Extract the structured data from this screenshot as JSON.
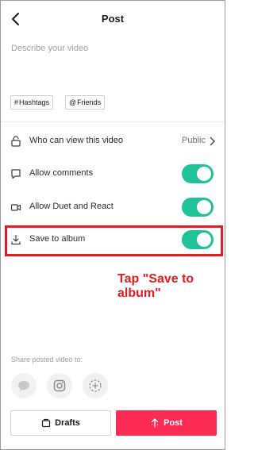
{
  "header": {
    "title": "Post"
  },
  "description": {
    "placeholder": "Describe your video"
  },
  "chips": {
    "hashtags_symbol": "#",
    "hashtags": "Hashtags",
    "friends_symbol": "@",
    "friends": "Friends"
  },
  "settings": {
    "who_can_view": {
      "label": "Who can view this video",
      "value": "Public"
    },
    "allow_comments": {
      "label": "Allow comments",
      "enabled": true
    },
    "allow_duet": {
      "label": "Allow Duet and React",
      "enabled": true
    },
    "save_to_album": {
      "label": "Save to album",
      "enabled": true
    }
  },
  "annotation": {
    "text": "Tap \"Save to album\""
  },
  "share": {
    "label": "Share posted video to:",
    "targets": [
      "message-icon",
      "instagram-icon",
      "more-icon"
    ]
  },
  "footer": {
    "drafts_label": "Drafts",
    "post_label": "Post"
  },
  "colors": {
    "toggle_on": "#20c29a",
    "post_button": "#fe2c55",
    "annotation": "#e8191f"
  }
}
